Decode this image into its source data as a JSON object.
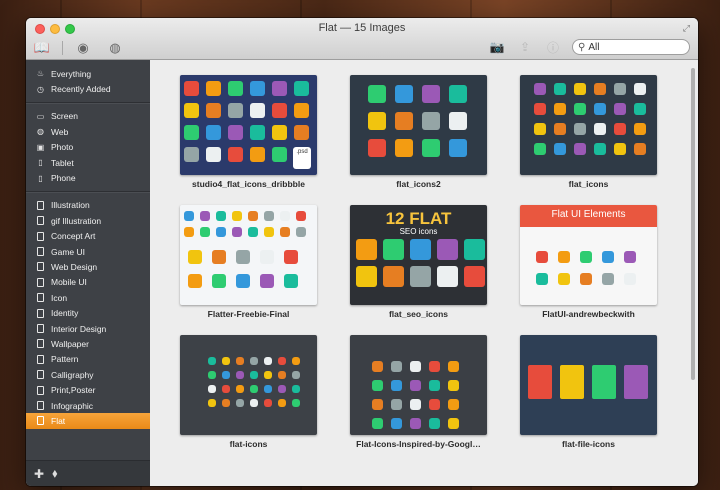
{
  "window": {
    "title": "Flat — 15 Images"
  },
  "toolbar": {
    "buttons": [
      {
        "icon": "book-icon",
        "glyph": "📖",
        "active": true
      },
      {
        "icon": "rss-icon",
        "glyph": "◉",
        "active": false
      },
      {
        "icon": "globe-icon",
        "glyph": "◍",
        "active": false
      }
    ],
    "right_icons": [
      {
        "icon": "camera-icon",
        "glyph": "📷",
        "enabled": true
      },
      {
        "icon": "share-icon",
        "glyph": "⇪",
        "enabled": false
      },
      {
        "icon": "info-icon",
        "glyph": "ⓘ",
        "enabled": false
      }
    ],
    "search": {
      "value": "All",
      "glyph": "⚲"
    }
  },
  "sidebar": {
    "groups": [
      {
        "items": [
          {
            "label": "Everything",
            "icon": "flame-icon",
            "glyph": "♨"
          },
          {
            "label": "Recently Added",
            "icon": "clock-icon",
            "glyph": "◷"
          }
        ]
      },
      {
        "items": [
          {
            "label": "Screen",
            "icon": "monitor-icon",
            "glyph": "▭"
          },
          {
            "label": "Web",
            "icon": "globe-icon",
            "glyph": "◍"
          },
          {
            "label": "Photo",
            "icon": "camera-icon",
            "glyph": "▣"
          },
          {
            "label": "Tablet",
            "icon": "tablet-icon",
            "glyph": "▯"
          },
          {
            "label": "Phone",
            "icon": "phone-icon",
            "glyph": "▯"
          }
        ]
      },
      {
        "items": [
          {
            "label": "Illustration",
            "icon": "document-icon"
          },
          {
            "label": "gif Illustration",
            "icon": "document-icon"
          },
          {
            "label": "Concept Art",
            "icon": "document-icon"
          },
          {
            "label": "Game UI",
            "icon": "document-icon"
          },
          {
            "label": "Web Design",
            "icon": "document-icon"
          },
          {
            "label": "Mobile UI",
            "icon": "document-icon"
          },
          {
            "label": "Icon",
            "icon": "document-icon"
          },
          {
            "label": "Identity",
            "icon": "document-icon"
          },
          {
            "label": "Interior Design",
            "icon": "document-icon"
          },
          {
            "label": "Wallpaper",
            "icon": "document-icon"
          },
          {
            "label": "Pattern",
            "icon": "document-icon"
          },
          {
            "label": "Calligraphy",
            "icon": "document-icon"
          },
          {
            "label": "Print,Poster",
            "icon": "document-icon"
          },
          {
            "label": "Infographic",
            "icon": "document-icon"
          },
          {
            "label": "Flat",
            "icon": "document-icon",
            "selected": true
          }
        ]
      }
    ],
    "bottom": {
      "add_glyph": "✚",
      "tag_glyph": "⬧"
    }
  },
  "colors": {
    "accent": "#f0941e",
    "sidebar": "#3e4146",
    "content": "#ededed"
  },
  "images": [
    {
      "caption": "studio4_flat_icons_dribbble",
      "bg": "#2b3a6b",
      "style": "iso",
      "badge": ".psd"
    },
    {
      "caption": "flat_icons2",
      "bg": "#2f3a46",
      "style": "icons2"
    },
    {
      "caption": "flat_icons",
      "bg": "#2f3a46",
      "style": "icons"
    },
    {
      "caption": "Flatter-Freebie-Final",
      "bg": "#f4f6f8",
      "style": "flatter"
    },
    {
      "caption": "flat_seo_icons",
      "bg": "#2d3035",
      "style": "seo",
      "headline": "12 FLAT",
      "sub": "SEO icons"
    },
    {
      "caption": "FlatUI-andrewbeckwith",
      "bg": "#f7f7f7",
      "style": "flatui",
      "headline": "Flat UI Elements"
    },
    {
      "caption": "flat-icons",
      "bg": "#3d4147",
      "style": "icons3"
    },
    {
      "caption": "Flat-Icons-Inspired-by-Googl…",
      "bg": "#3b3f45",
      "style": "google"
    },
    {
      "caption": "flat-file-icons",
      "bg": "#2e3f55",
      "style": "files"
    }
  ]
}
